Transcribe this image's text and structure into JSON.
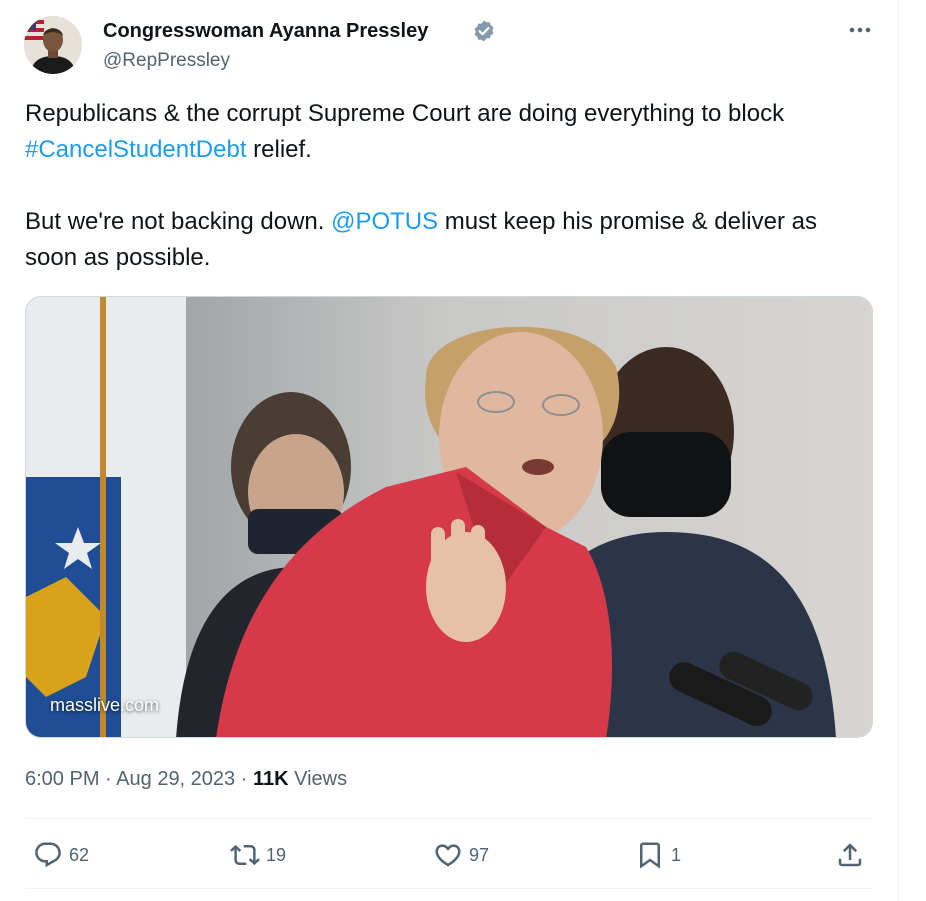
{
  "author": {
    "name": "Congresswoman Ayanna Pressley",
    "handle": "@RepPressley",
    "verified": true
  },
  "tweet": {
    "line1_text": "Republicans & the corrupt Supreme Court are doing everything to block",
    "hashtag": "#CancelStudentDebt",
    "line1_suffix": " relief.",
    "line2_prefix": "But we're not backing down. ",
    "mention": "@POTUS",
    "line2_suffix": " must keep his promise & deliver as soon as possible."
  },
  "media": {
    "source": "masslive.com"
  },
  "meta": {
    "time": "6:00 PM",
    "separator": "·",
    "date": "Aug 29, 2023",
    "views_count": "11K",
    "views_label": "Views"
  },
  "actions": {
    "replies": "62",
    "reposts": "19",
    "likes": "97",
    "bookmarks": "1"
  },
  "icons": {
    "reply": "reply-icon",
    "repost": "repost-icon",
    "like": "heart-icon",
    "bookmark": "bookmark-icon",
    "share": "share-icon",
    "more": "more-icon",
    "verified": "verified-badge-icon"
  },
  "colors": {
    "link": "#1d9bf0",
    "secondary_text": "#536471",
    "primary_text": "#0f1419",
    "verified_badge": "#829aab"
  }
}
